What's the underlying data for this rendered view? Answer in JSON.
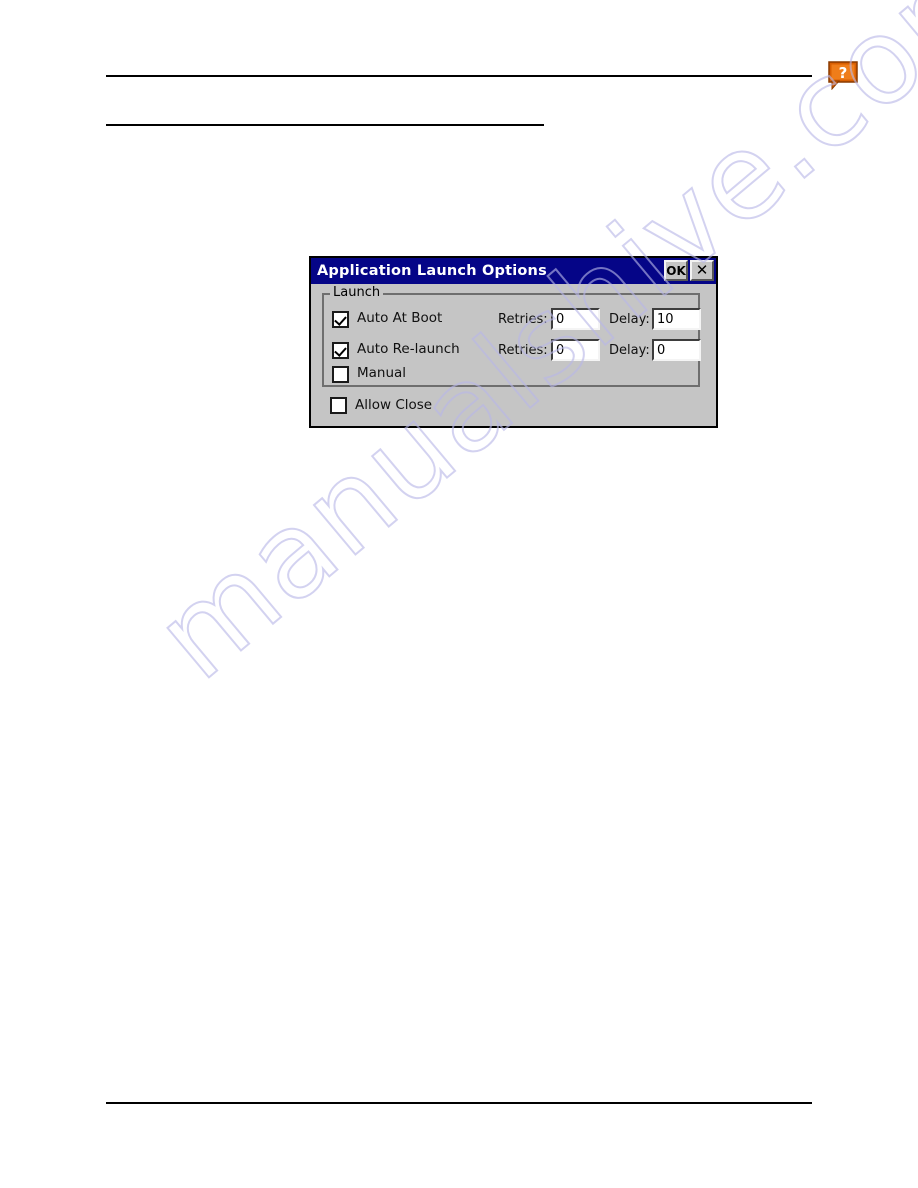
{
  "page": {
    "rules": [
      {
        "name": "header-top-rule"
      },
      {
        "name": "header-sub-rule"
      },
      {
        "name": "footer-rule"
      }
    ],
    "watermark": "manualshive.com",
    "watermark_color": "#b9b8e8",
    "help_icon": {
      "name": "help-question-icon",
      "glyph": "?",
      "color": "#e06000"
    }
  },
  "dialog": {
    "title": "Application Launch Options",
    "titlebar_color": "#050587",
    "face_color": "#c5c5c5",
    "buttons": {
      "ok_label": "OK",
      "close_label": "✕"
    },
    "group": {
      "label": "Launch",
      "rows": [
        {
          "checkbox_label": "Auto At Boot",
          "checked": true,
          "retries_label": "Retries:",
          "retries_value": "0",
          "delay_label": "Delay:",
          "delay_value": "10"
        },
        {
          "checkbox_label": "Auto Re-launch",
          "checked": true,
          "retries_label": "Retries:",
          "retries_value": "0",
          "delay_label": "Delay:",
          "delay_value": "0"
        },
        {
          "checkbox_label": "Manual",
          "checked": false
        }
      ]
    },
    "allow_close": {
      "label": "Allow Close",
      "checked": false
    }
  }
}
